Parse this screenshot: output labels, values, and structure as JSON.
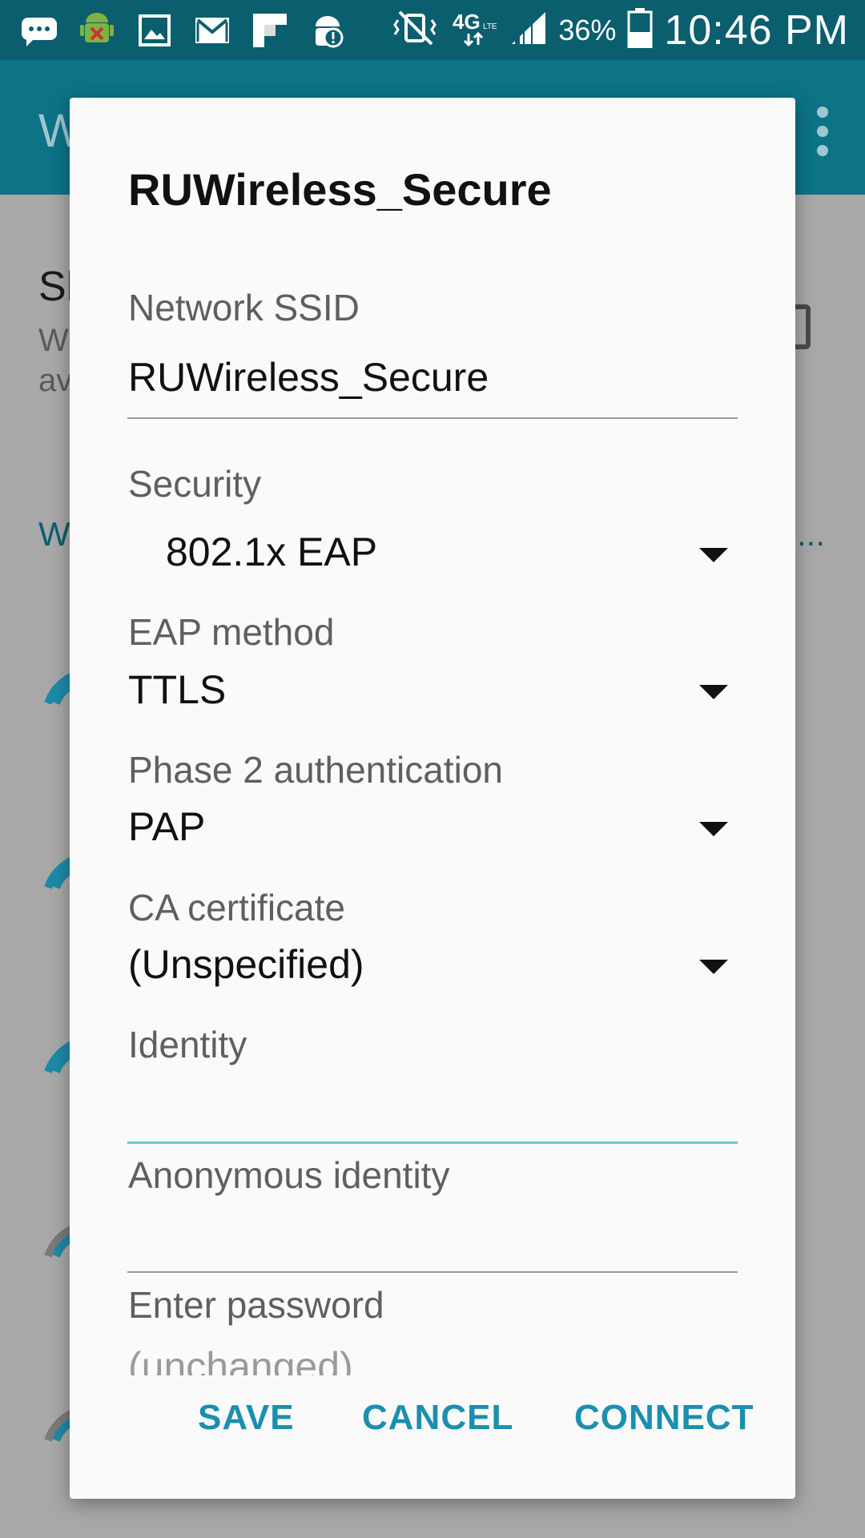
{
  "status_bar": {
    "icons": [
      "message-icon",
      "android-debug-icon",
      "image-icon",
      "gmail-icon",
      "flipboard-icon",
      "android-alert-icon"
    ],
    "network": "4G",
    "battery_percent": "36%",
    "time": "10:46 PM"
  },
  "background": {
    "appbar_title": "W",
    "heading": "Sl",
    "sub_line1": "W",
    "sub_line2": "av",
    "section_label": "W",
    "section_right": "l..."
  },
  "dialog": {
    "title": "RUWireless_Secure",
    "ssid_label": "Network SSID",
    "ssid_value": "RUWireless_Secure",
    "security_label": "Security",
    "security_value": "802.1x EAP",
    "eap_label": "EAP method",
    "eap_value": "TTLS",
    "phase2_label": "Phase 2 authentication",
    "phase2_value": "PAP",
    "ca_label": "CA certificate",
    "ca_value": "(Unspecified)",
    "identity_label": "Identity",
    "identity_value": "",
    "anon_label": "Anonymous identity",
    "anon_value": "",
    "password_label": "Enter password",
    "password_placeholder": "(unchanged)",
    "buttons": {
      "save": "SAVE",
      "cancel": "CANCEL",
      "connect": "CONNECT"
    }
  },
  "colors": {
    "accent": "#1a8fb0",
    "appbar": "#0d7387",
    "statusbar": "#0a5e6e",
    "focus_line": "#72c5d8"
  }
}
